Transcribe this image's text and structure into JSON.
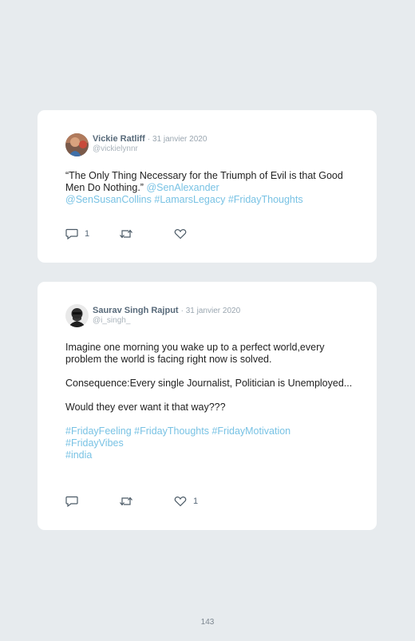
{
  "tweets": [
    {
      "name": "Vickie Ratliff",
      "date": "· 31 janvier 2020",
      "handle": "@vickielynnr",
      "text_plain": "“The Only Thing Necessary for the Triumph of Evil is that Good Men Do Nothing.” ",
      "links": [
        "@SenAlexander",
        "@SenSusanCollins",
        "#LamarsLegacy",
        "#FridayThoughts"
      ],
      "reply_count": "1",
      "retweet_count": "",
      "like_count": ""
    },
    {
      "name": "Saurav Singh Rajput",
      "date": "· 31 janvier 2020",
      "handle": "@i_singh_",
      "paragraphs": [
        "Imagine one morning you wake up to a perfect world,every problem the world is facing right now is solved.",
        "Consequence:Every single Journalist, Politician is Unemployed...",
        "Would they ever want it that way???"
      ],
      "hashtags": [
        "#FridayFeeling",
        "#FridayThoughts",
        "#FridayMotivation",
        "#FridayVibes",
        "#india"
      ],
      "reply_count": "",
      "retweet_count": "",
      "like_count": "1"
    }
  ],
  "icons": {
    "reply": "reply-icon",
    "retweet": "retweet-icon",
    "like": "heart-icon"
  },
  "colors": {
    "link": "#78c2e4",
    "background": "#e7ebee",
    "card": "#ffffff"
  },
  "page_number": "143"
}
